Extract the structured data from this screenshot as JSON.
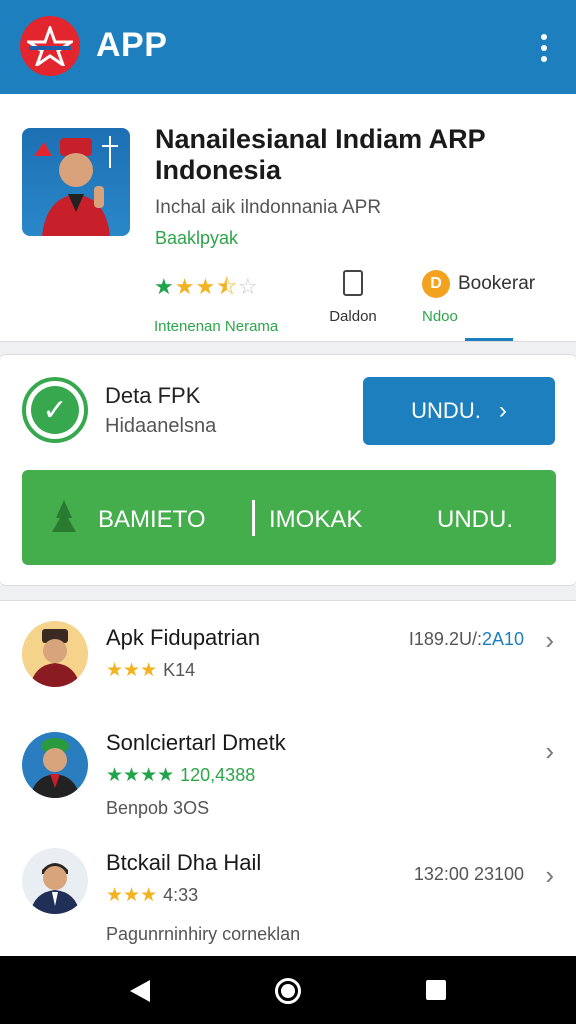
{
  "appbar": {
    "title": "APP",
    "logo_icon": "star-emblem-icon",
    "menu_icon": "more-vert-icon"
  },
  "app": {
    "name": "Nanailesianal Indiam ARP Indonesia",
    "subtitle": "Inchal aik ilndonnania APR",
    "developer": "Baaklpyak",
    "stars_filled": 3.5,
    "rating_label": "Intenenan Nerama",
    "size_label": "Daldon",
    "bookmark_label": "Bookerar",
    "bookmark_sub": "Ndoo",
    "bookmark_glyph": "D"
  },
  "download": {
    "title": "Deta FPK",
    "subtitle": "Hidaanelsna",
    "button_label": "UNDU.",
    "green": {
      "left": "BAMIETO",
      "middle": "IMOKAK",
      "right": "UNDU."
    }
  },
  "list": [
    {
      "title": "Apk Fidupatrian",
      "stars": 3,
      "rating_text": "K14",
      "meta_a": "I189.2U/:",
      "meta_b": "2A10",
      "sub": ""
    },
    {
      "title": "Sonlciertarl Dmetk",
      "stars": 4,
      "rating_text": "120,4388",
      "meta_a": "",
      "meta_b": "",
      "sub": "Benpob 3OS"
    },
    {
      "title": "Btckail Dha Hail",
      "stars": 3,
      "rating_text": "4:33",
      "meta_a": "132:00 23100",
      "meta_b": "",
      "sub": "Pagunrninhiry corneklan"
    }
  ],
  "colors": {
    "primary": "#1d7fbd",
    "green": "#44ad4c",
    "star_yellow": "#f3b21f",
    "star_green": "#21a34a"
  },
  "nav": {
    "back_icon": "back-triangle-icon",
    "home_icon": "home-circle-icon",
    "recent_icon": "recent-square-icon"
  }
}
